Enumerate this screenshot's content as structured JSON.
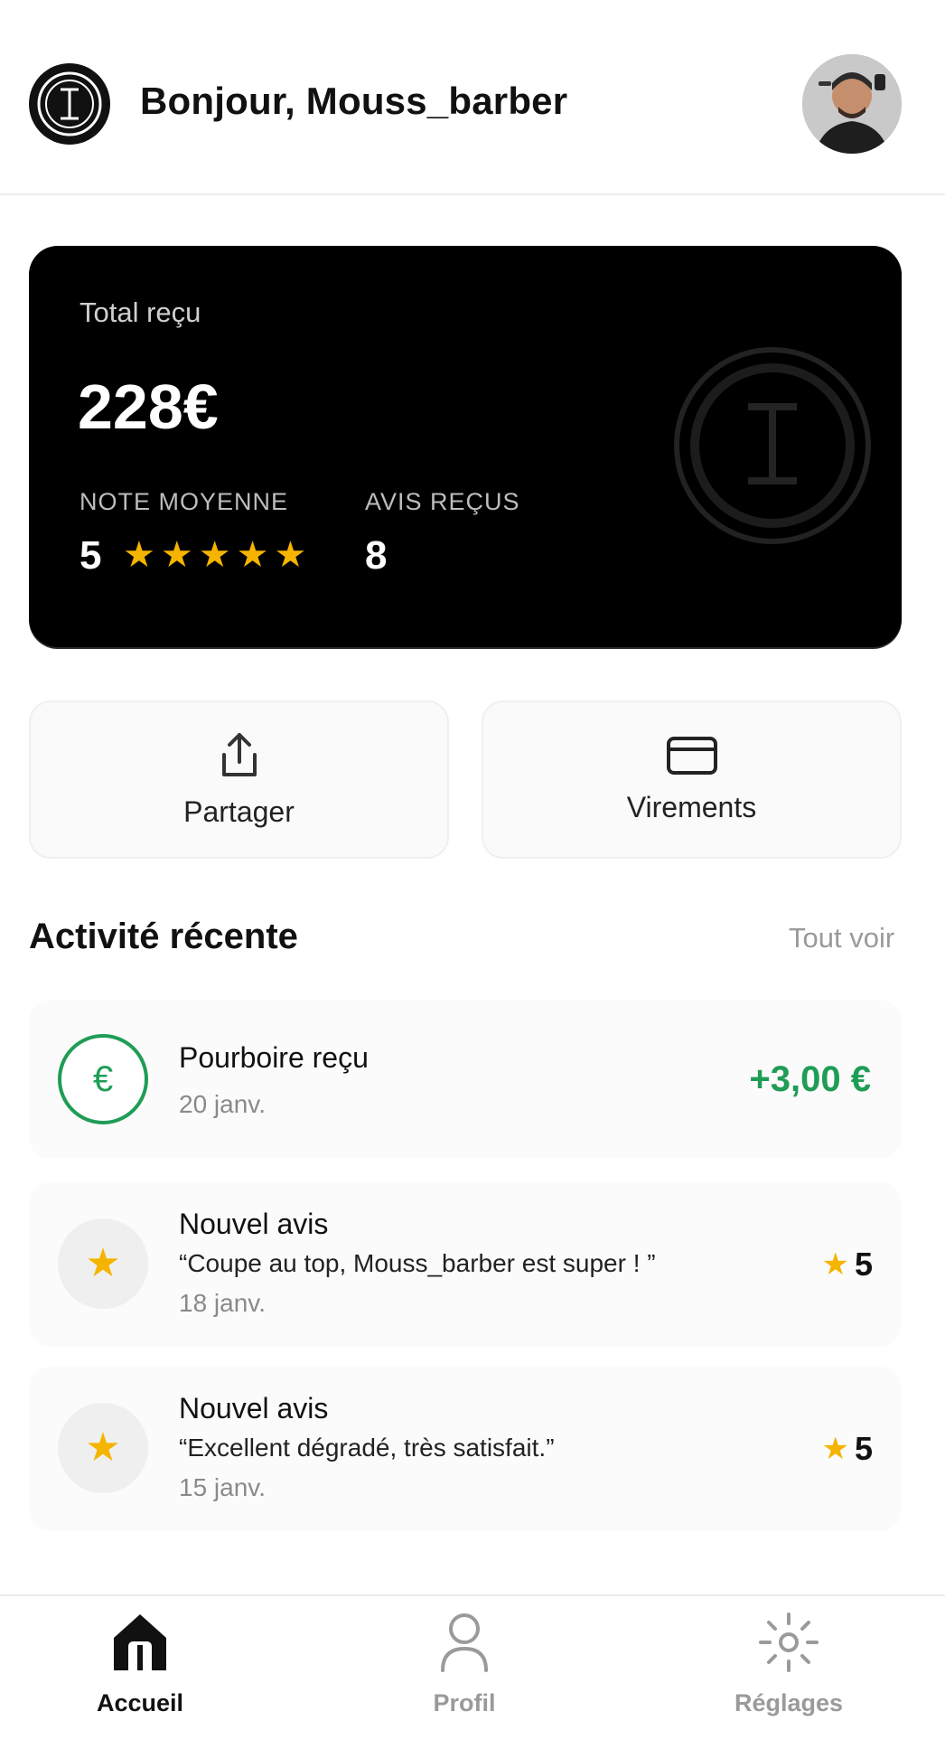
{
  "header": {
    "greeting": "Bonjour, Mouss_barber",
    "logo_icon": "barber-logo-icon",
    "avatar_icon": "user-avatar"
  },
  "card": {
    "label": "Total reçu",
    "amount": "228€",
    "rating_label": "NOTE MOYENNE",
    "rating_value": "5",
    "rating_stars": 5,
    "reviews_label": "AVIS REÇUS",
    "reviews_value": "8"
  },
  "actions": [
    {
      "label": "Partager",
      "icon": "share-icon"
    },
    {
      "label": "Virements",
      "icon": "credit-card-icon"
    }
  ],
  "recent": {
    "title": "Activité récente",
    "see_all": "Tout voir",
    "items": [
      {
        "type": "tip",
        "title": "Pourboire reçu",
        "date": "20 janv.",
        "amount": "+3,00 €",
        "icon": "euro-icon"
      },
      {
        "type": "review",
        "title": "Nouvel avis",
        "quote": "“Coupe au top, Mouss_barber est super ! ”",
        "date": "18 janv.",
        "rating": "5",
        "icon": "star-icon"
      },
      {
        "type": "review",
        "title": "Nouvel avis",
        "quote": "“Excellent dégradé, très satisfait.”",
        "date": "15 janv.",
        "rating": "5",
        "icon": "star-icon"
      }
    ]
  },
  "nav": [
    {
      "label": "Accueil",
      "icon": "home-icon",
      "active": true
    },
    {
      "label": "Profil",
      "icon": "user-icon",
      "active": false
    },
    {
      "label": "Réglages",
      "icon": "settings-icon",
      "active": false
    }
  ],
  "colors": {
    "accent_green": "#1f9d55",
    "star_yellow": "#f5b400",
    "card_bg": "#000000",
    "nav_active": "#111111",
    "nav_inactive": "#9a9a9a"
  }
}
